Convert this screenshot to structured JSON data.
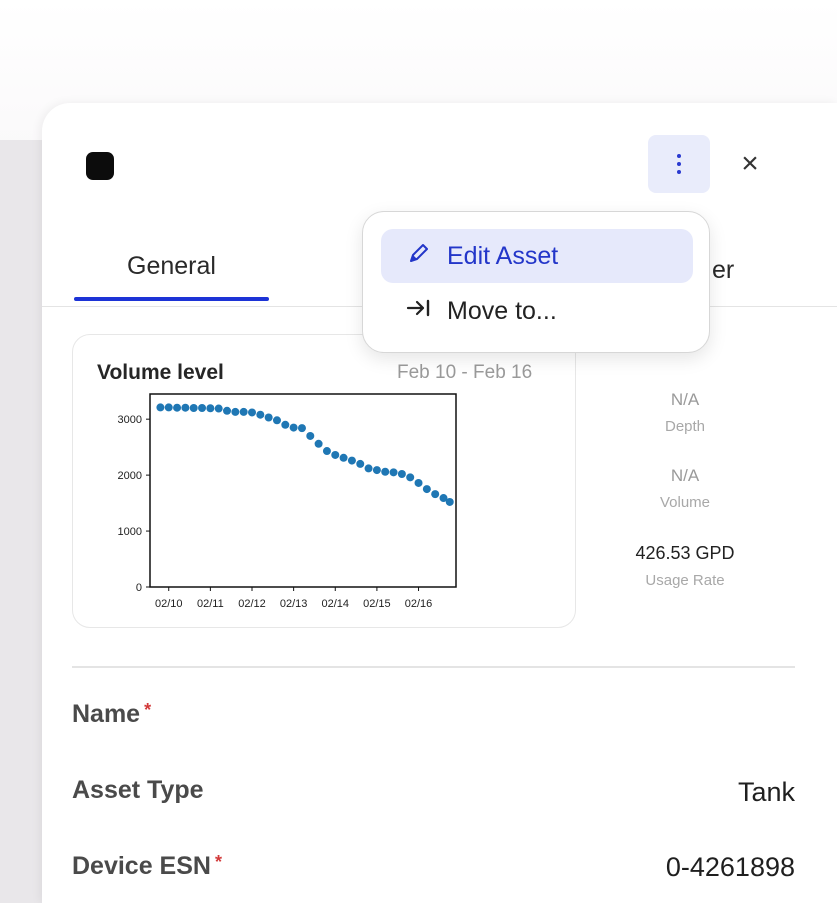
{
  "window": {
    "close_symbol": "×"
  },
  "tabs": [
    {
      "label": "General"
    },
    {
      "label": "er"
    }
  ],
  "menu": {
    "items": [
      {
        "label": "Edit Asset",
        "icon": "pencil-icon"
      },
      {
        "label": "Move to...",
        "icon": "move-to-icon"
      }
    ]
  },
  "chart_card": {
    "title": "Volume level",
    "date_range": "Feb 10 - Feb 16"
  },
  "chart_data": {
    "type": "scatter",
    "title": "",
    "xlabel": "",
    "ylabel": "",
    "xtick_labels": [
      "02/10",
      "02/11",
      "02/12",
      "02/13",
      "02/14",
      "02/15",
      "02/16"
    ],
    "yticks": [
      0,
      1000,
      2000,
      3000
    ],
    "ylim": [
      0,
      3450
    ],
    "xlim": [
      9.55,
      16.9
    ],
    "x_unit": "day of Feb",
    "series": [
      {
        "color": "#1f77b4",
        "points": [
          [
            9.8,
            3210
          ],
          [
            10.0,
            3210
          ],
          [
            10.2,
            3205
          ],
          [
            10.4,
            3205
          ],
          [
            10.6,
            3200
          ],
          [
            10.8,
            3200
          ],
          [
            11.0,
            3195
          ],
          [
            11.2,
            3190
          ],
          [
            11.4,
            3150
          ],
          [
            11.6,
            3130
          ],
          [
            11.8,
            3130
          ],
          [
            12.0,
            3120
          ],
          [
            12.2,
            3080
          ],
          [
            12.4,
            3030
          ],
          [
            12.6,
            2980
          ],
          [
            12.8,
            2900
          ],
          [
            13.0,
            2850
          ],
          [
            13.2,
            2840
          ],
          [
            13.4,
            2700
          ],
          [
            13.6,
            2560
          ],
          [
            13.8,
            2430
          ],
          [
            14.0,
            2360
          ],
          [
            14.2,
            2310
          ],
          [
            14.4,
            2260
          ],
          [
            14.6,
            2200
          ],
          [
            14.8,
            2120
          ],
          [
            15.0,
            2090
          ],
          [
            15.2,
            2060
          ],
          [
            15.4,
            2050
          ],
          [
            15.6,
            2020
          ],
          [
            15.8,
            1960
          ],
          [
            16.0,
            1860
          ],
          [
            16.2,
            1750
          ],
          [
            16.4,
            1660
          ],
          [
            16.6,
            1590
          ],
          [
            16.75,
            1520
          ]
        ]
      }
    ]
  },
  "stats": [
    {
      "value": "N/A",
      "label": "Depth"
    },
    {
      "value": "N/A",
      "label": "Volume"
    },
    {
      "value": "426.53 GPD",
      "label": "Usage Rate"
    }
  ],
  "fields": [
    {
      "label": "Name",
      "required": "*",
      "value": ""
    },
    {
      "label": "Asset Type",
      "required": "",
      "value": "Tank"
    },
    {
      "label": "Device ESN",
      "required": "*",
      "value": "0-4261898"
    }
  ],
  "colors": {
    "accent": "#1c33d6",
    "menu_highlight": "#e6e9fb",
    "required": "#d23a3a"
  }
}
